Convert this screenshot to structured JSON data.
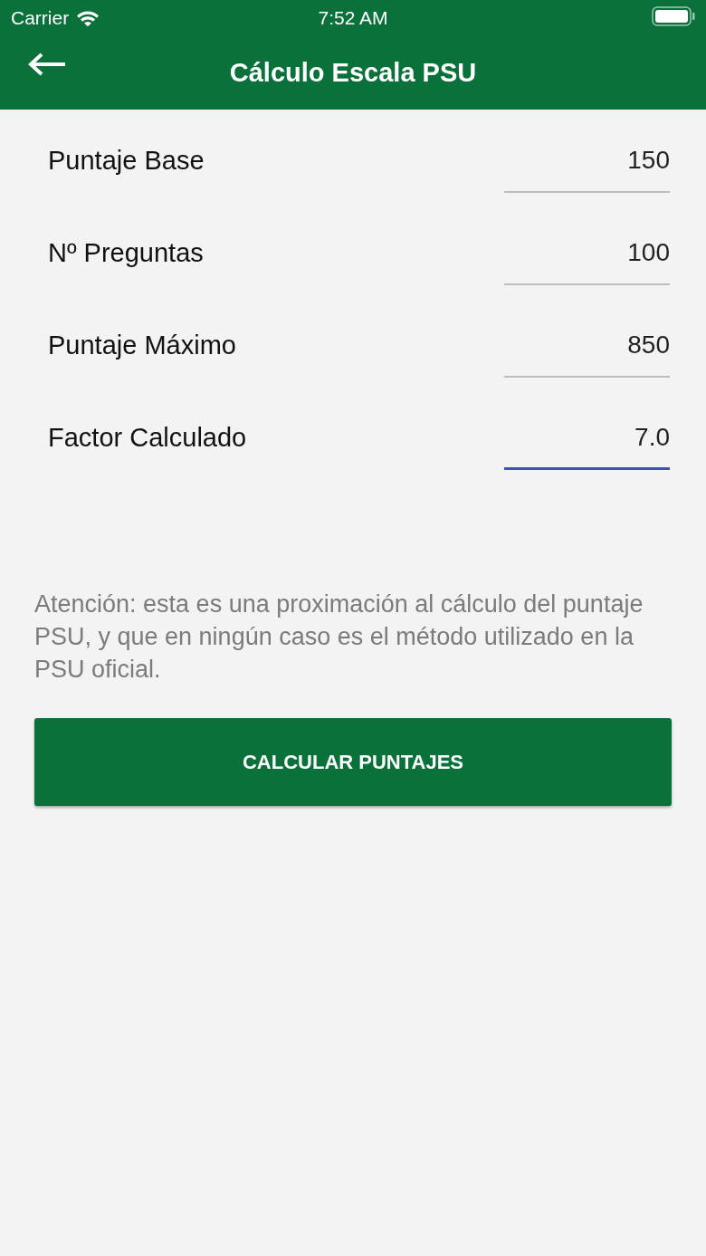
{
  "status_bar": {
    "carrier": "Carrier",
    "time": "7:52 AM"
  },
  "nav_bar": {
    "title": "Cálculo Escala PSU"
  },
  "fields": [
    {
      "label": "Puntaje Base",
      "value": "150",
      "focused": false
    },
    {
      "label": "Nº Preguntas",
      "value": "100",
      "focused": false
    },
    {
      "label": "Puntaje Máximo",
      "value": "850",
      "focused": false
    },
    {
      "label": "Factor Calculado",
      "value": "7.0",
      "focused": true
    }
  ],
  "notice": "Atención: esta es una proximación al cálculo del puntaje PSU, y que en ningún caso es el método utilizado en la PSU oficial.",
  "button": "CALCULAR PUNTAJES"
}
